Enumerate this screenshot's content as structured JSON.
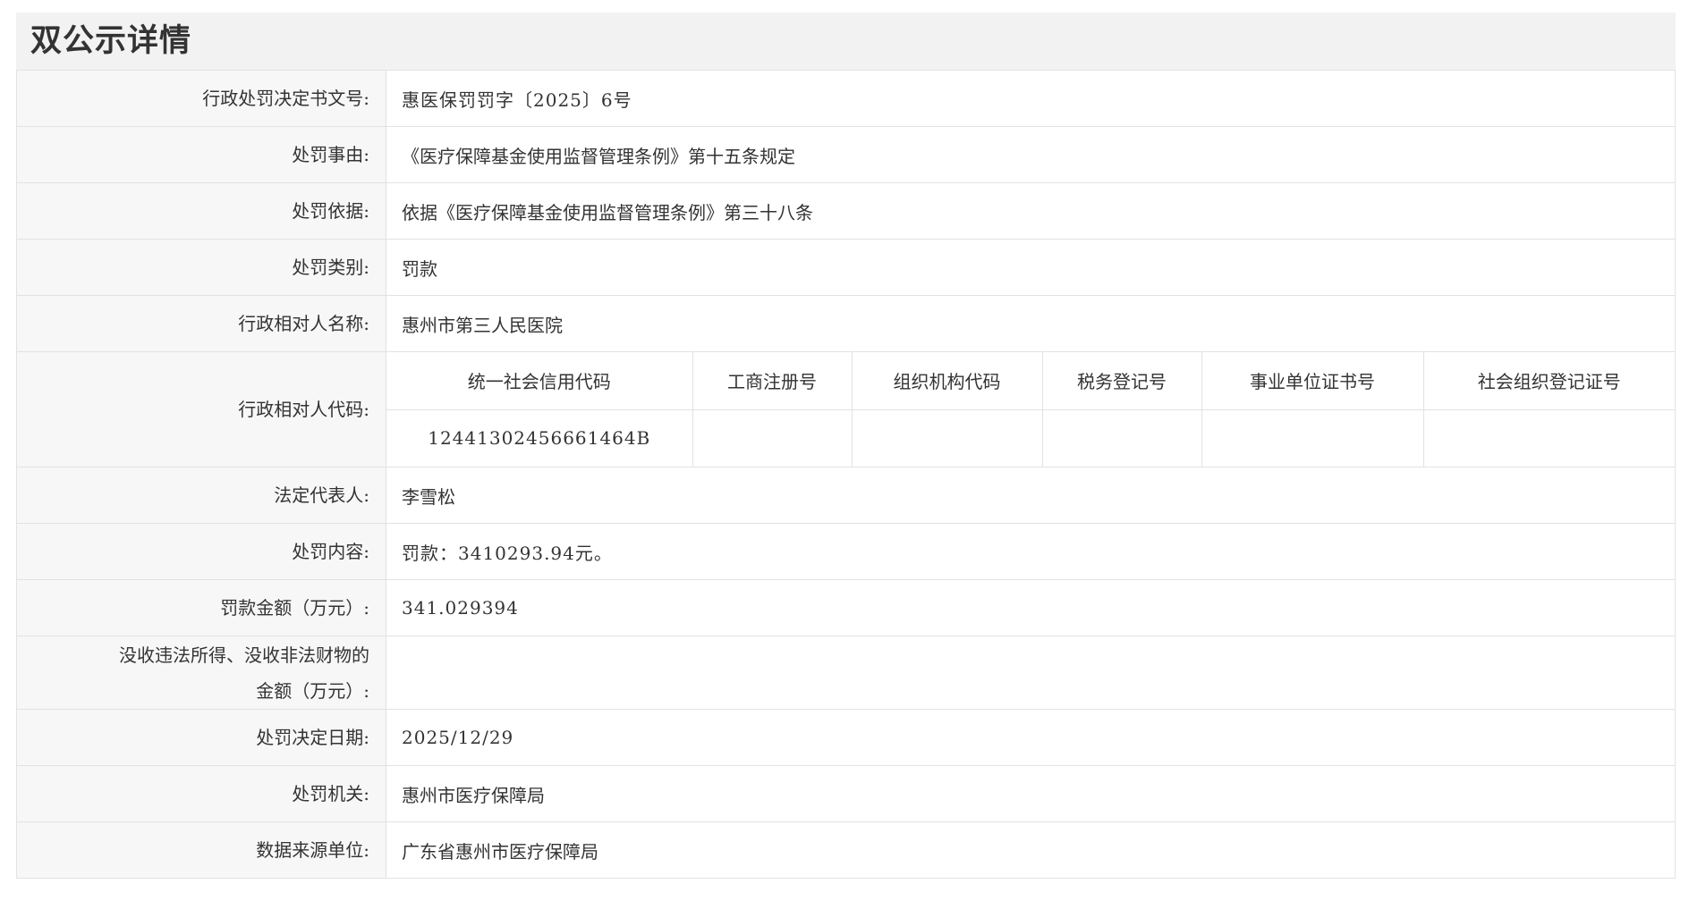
{
  "page": {
    "title": "双公示详情"
  },
  "rows": {
    "decision_no": {
      "label": "行政处罚决定书文号:",
      "value": "惠医保罚罚字〔2025〕6号"
    },
    "reason": {
      "label": "处罚事由:",
      "value": "《医疗保障基金使用监督管理条例》第十五条规定"
    },
    "basis": {
      "label": "处罚依据:",
      "value": "依据《医疗保障基金使用监督管理条例》第三十八条"
    },
    "category": {
      "label": "处罚类别:",
      "value": "罚款"
    },
    "party_name": {
      "label": "行政相对人名称:",
      "value": "惠州市第三人民医院"
    },
    "party_code": {
      "label": "行政相对人代码:",
      "headers": [
        "统一社会信用代码",
        "工商注册号",
        "组织机构代码",
        "税务登记号",
        "事业单位证书号",
        "社会组织登记证号"
      ],
      "values": [
        "12441302456661464B",
        "",
        "",
        "",
        "",
        ""
      ]
    },
    "legal_rep": {
      "label": "法定代表人:",
      "value": "李雪松"
    },
    "content": {
      "label": "处罚内容:",
      "value": "罚款：3410293.94元。"
    },
    "fine_amount": {
      "label": "罚款金额（万元）:",
      "value": "341.029394"
    },
    "confiscation": {
      "label_line1": "没收违法所得、没收非法财物的",
      "label_line2": "金额（万元）:",
      "value": ""
    },
    "decision_date": {
      "label": "处罚决定日期:",
      "value": "2025/12/29"
    },
    "authority": {
      "label": "处罚机关:",
      "value": "惠州市医疗保障局"
    },
    "data_source": {
      "label": "数据来源单位:",
      "value": "广东省惠州市医疗保障局"
    }
  }
}
